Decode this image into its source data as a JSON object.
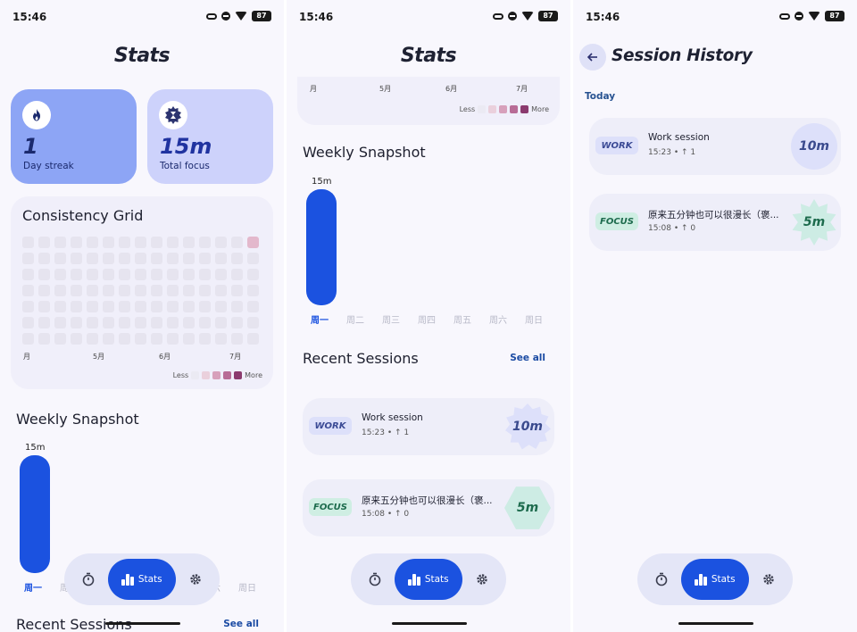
{
  "status": {
    "time": "15:46",
    "battery": "87"
  },
  "stats": {
    "title": "Stats",
    "streak": {
      "value": "1",
      "label": "Day streak"
    },
    "total_focus": {
      "value": "15m",
      "label": "Total focus"
    },
    "consistency": {
      "title": "Consistency Grid",
      "months": [
        "月",
        "5月",
        "6月",
        "7月"
      ],
      "legend_less": "Less",
      "legend_more": "More",
      "legend_colors": [
        "#ebeaf3",
        "#ead0dc",
        "#d7a0bb",
        "#b86c96",
        "#8b3a6e"
      ]
    },
    "weekly": {
      "title": "Weekly Snapshot",
      "bar_value": "15m",
      "days": [
        "周一",
        "周二",
        "周三",
        "周四",
        "周五",
        "周六",
        "周日"
      ],
      "minutes": [
        15,
        0,
        0,
        0,
        0,
        0,
        0
      ]
    },
    "recent": {
      "title": "Recent Sessions",
      "see_all": "See all",
      "sessions": [
        {
          "tag": "WORK",
          "title": "Work session",
          "time": "15:23",
          "bullet": "•",
          "count": "↑ 1",
          "duration": "10m"
        },
        {
          "tag": "FOCUS",
          "title": "原来五分钟也可以很漫长（褒...",
          "time": "15:08",
          "bullet": "•",
          "count": "↑ 0",
          "duration": "5m"
        }
      ]
    }
  },
  "nav": {
    "stats_label": "Stats"
  },
  "history": {
    "title": "Session History",
    "group": "Today",
    "sessions": [
      {
        "tag": "WORK",
        "title": "Work session",
        "time": "15:23",
        "bullet": "•",
        "count": "↑ 1",
        "duration": "10m"
      },
      {
        "tag": "FOCUS",
        "title": "原来五分钟也可以很漫长（褒...",
        "time": "15:08",
        "bullet": "•",
        "count": "↑ 0",
        "duration": "5m"
      }
    ]
  },
  "colors": {
    "accent": "#1b52e0",
    "streak_card": "#8da5f5",
    "total_card": "#cdd2fb",
    "grid_active": "#e3b8cc"
  }
}
